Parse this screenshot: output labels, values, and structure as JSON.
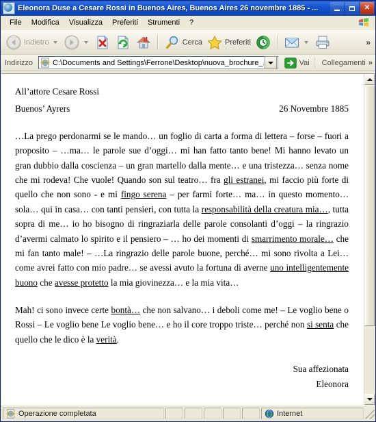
{
  "window": {
    "title": "Eleonora Duse a Cesare Rossi in Buenos Aires, Buenos Aires 26 novembre 1885 - ...",
    "app_icon": "ie-document-icon",
    "minimize_label": "Riduci a icona",
    "maximize_label": "Ingrandisci",
    "close_label": "Chiudi"
  },
  "menu": {
    "items": [
      {
        "label": "File"
      },
      {
        "label": "Modifica"
      },
      {
        "label": "Visualizza"
      },
      {
        "label": "Preferiti"
      },
      {
        "label": "Strumenti"
      },
      {
        "label": "?"
      }
    ],
    "brand_icon": "windows-flag-icon"
  },
  "toolbar": {
    "back_label": "Indietro",
    "back_icon": "arrow-left-icon",
    "forward_icon": "arrow-right-icon",
    "stop_icon": "stop-page-icon",
    "refresh_icon": "refresh-page-icon",
    "home_icon": "home-icon",
    "search_label": "Cerca",
    "search_icon": "magnifier-icon",
    "favorites_label": "Preferiti",
    "favorites_icon": "star-icon",
    "history_icon": "history-clock-icon",
    "mail_icon": "mail-envelope-icon",
    "print_icon": "printer-icon",
    "overflow_label": "»"
  },
  "address_bar": {
    "label": "Indirizzo",
    "value": "C:\\Documents and Settings\\Ferrone\\Desktop\\nuova_brochure_.",
    "placeholder": "C:\\",
    "field_icon": "ie-page-icon",
    "dropdown_icon": "chevron-down-icon",
    "go_label": "Vai",
    "go_icon": "green-arrow-go-icon",
    "links_label": "Collegamenti",
    "overflow_label": "»"
  },
  "document": {
    "recipient": "All’attore Cesare Rossi",
    "place": "Buenos’ Ayrers",
    "date": "26 Novembre 1885",
    "paragraph1": [
      {
        "t": "…La prego perdonarmi se le mando… un foglio di carta a forma di lettera – forse – fuori a proposito – …ma… le parole sue d’oggi… mi han fatto tanto bene! Mi hanno levato un gran dubbio dalla coscienza – un gran martello dalla mente… e una tristezza… senza nome che mi rodeva! Che vuole! Quando son sul teatro… fra ",
        "u": false
      },
      {
        "t": "gli estranei",
        "u": true
      },
      {
        "t": ", mi faccio più forte di quello che non sono - e mi ",
        "u": false
      },
      {
        "t": "fingo serena",
        "u": true
      },
      {
        "t": " – per farmi forte… ma… in questo momento… sola… qui in casa… con tanti pensieri, con tutta la ",
        "u": false
      },
      {
        "t": "responsabilità della creatura mia…",
        "u": true
      },
      {
        "t": ", tutta sopra di me… io ho bisogno di ringraziarla delle parole consolanti d’oggi – la ringrazio d’avermi calmato lo spirito e il pensiero – … ho dei momenti di ",
        "u": false
      },
      {
        "t": "smarrimento morale…",
        "u": true
      },
      {
        "t": " che mi fan tanto male! – …La ringrazio delle parole buone, perché… mi sono rivolta a Lei… come avrei fatto con mio padre… se avessi avuto la fortuna di averne ",
        "u": false
      },
      {
        "t": "uno intelligentemente buono",
        "u": true
      },
      {
        "t": " che ",
        "u": false
      },
      {
        "t": "avesse protetto",
        "u": true
      },
      {
        "t": " la mia giovinezza… e la mia vita…",
        "u": false
      }
    ],
    "paragraph2": [
      {
        "t": "Mah! ci sono invece certe ",
        "u": false
      },
      {
        "t": "bontà…",
        "u": true
      },
      {
        "t": " che non salvano… i deboli come me! – Le voglio bene o Rossi – Le voglio bene Le voglio bene… e ho il core troppo triste… perché non ",
        "u": false
      },
      {
        "t": "si senta",
        "u": true
      },
      {
        "t": " che quello che le dico è la ",
        "u": false
      },
      {
        "t": "verità",
        "u": true
      },
      {
        "t": ".",
        "u": false
      }
    ],
    "signature_line1": "Sua affezionata",
    "signature_line2": "Eleonora"
  },
  "scrollbar": {
    "up_icon": "scroll-up-arrow-icon",
    "down_icon": "scroll-down-arrow-icon",
    "thumb_label": "vertical-scroll-thumb"
  },
  "status_bar": {
    "message": "Operazione completata",
    "message_icon": "ie-page-icon",
    "zone_label": "Internet",
    "zone_icon": "globe-icon"
  },
  "colors": {
    "titlebar_blue": "#0a46bb",
    "chrome_beige": "#ece9d8",
    "page_white": "#ffffff",
    "go_green": "#2a9a34",
    "close_red": "#cf4526"
  }
}
